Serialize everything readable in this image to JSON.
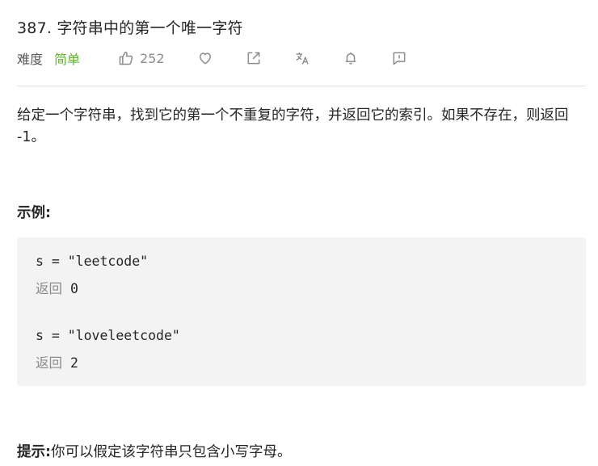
{
  "problem": {
    "title": "387. 字符串中的第一个唯一字符",
    "difficulty_label": "难度",
    "difficulty_value": "简单",
    "likes": "252",
    "icons": [
      "thumbs-up-icon",
      "heart-icon",
      "share-icon",
      "translate-icon",
      "bell-icon",
      "feedback-icon"
    ]
  },
  "description": {
    "text": "给定一个字符串，找到它的第一个不重复的字符，并返回它的索引。如果不存在，则返回 -1。"
  },
  "example": {
    "title": "示例:",
    "return_label": "返回",
    "cases": [
      {
        "input": "s = \"leetcode\"",
        "output": "0"
      },
      {
        "input": "s = \"loveleetcode\"",
        "output": "2"
      }
    ]
  },
  "tip": {
    "label": "提示:",
    "text": "你可以假定该字符串只包含小写字母。"
  },
  "colors": {
    "easy": "#5ab726",
    "icon": "#8c8c8c",
    "code_bg": "#f3f3f3",
    "divider": "#e0e0e0"
  }
}
